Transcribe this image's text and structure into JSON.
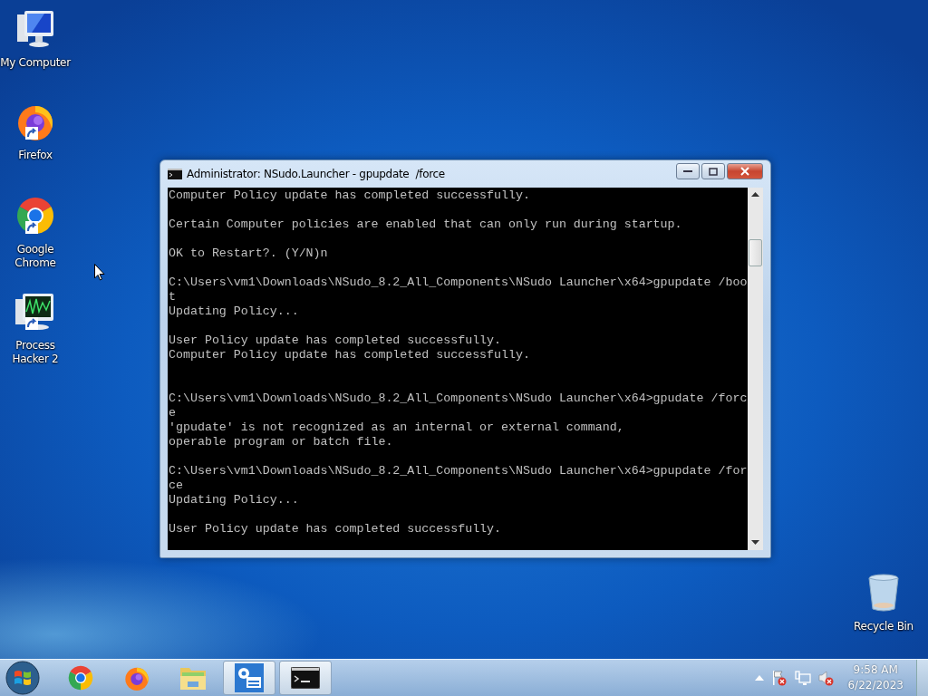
{
  "desktop_icons": [
    {
      "label": "My Computer",
      "kind": "computer",
      "shortcut": false
    },
    {
      "label": "Firefox",
      "kind": "firefox",
      "shortcut": true
    },
    {
      "label": "Google Chrome",
      "kind": "chrome",
      "shortcut": true
    },
    {
      "label": "Process Hacker 2",
      "kind": "monitor",
      "shortcut": true
    },
    {
      "label": "Recycle Bin",
      "kind": "bin",
      "shortcut": false
    }
  ],
  "window": {
    "title": "Administrator: NSudo.Launcher - gpupdate  /force",
    "console": {
      "blocks": [
        {
          "lines": [
            "Computer Policy update has completed successfully."
          ],
          "extra_gap": false
        },
        {
          "lines": [
            "Certain Computer policies are enabled that can only run during startup."
          ],
          "extra_gap": false
        },
        {
          "lines": [
            "OK to Restart?. (Y/N)n"
          ],
          "extra_gap": false
        },
        {
          "lines": [
            "C:\\Users\\vm1\\Downloads\\NSudo_8.2_All_Components\\NSudo Launcher\\x64>gpupdate /boo",
            "t",
            "Updating Policy..."
          ],
          "extra_gap": false
        },
        {
          "lines": [
            "User Policy update has completed successfully.",
            "Computer Policy update has completed successfully."
          ],
          "extra_gap": true
        },
        {
          "lines": [
            "C:\\Users\\vm1\\Downloads\\NSudo_8.2_All_Components\\NSudo Launcher\\x64>gpudate /forc",
            "e",
            "'gpudate' is not recognized as an internal or external command,",
            "operable program or batch file."
          ],
          "extra_gap": false
        },
        {
          "lines": [
            "C:\\Users\\vm1\\Downloads\\NSudo_8.2_All_Components\\NSudo Launcher\\x64>gpupdate /for",
            "ce",
            "Updating Policy..."
          ],
          "extra_gap": false
        },
        {
          "lines": [
            "User Policy update has completed successfully."
          ],
          "extra_gap": false
        }
      ]
    }
  },
  "taskbar": {
    "items": [
      {
        "kind": "chrome",
        "active": false
      },
      {
        "kind": "firefox",
        "active": false
      },
      {
        "kind": "folder",
        "active": false
      },
      {
        "kind": "settings",
        "active": true
      },
      {
        "kind": "console",
        "active": true
      }
    ],
    "tray": [
      {
        "kind": "arrow"
      },
      {
        "kind": "flag"
      },
      {
        "kind": "network"
      },
      {
        "kind": "speaker"
      }
    ],
    "clock": {
      "time": "9:58 AM",
      "date": "6/22/2023"
    }
  }
}
